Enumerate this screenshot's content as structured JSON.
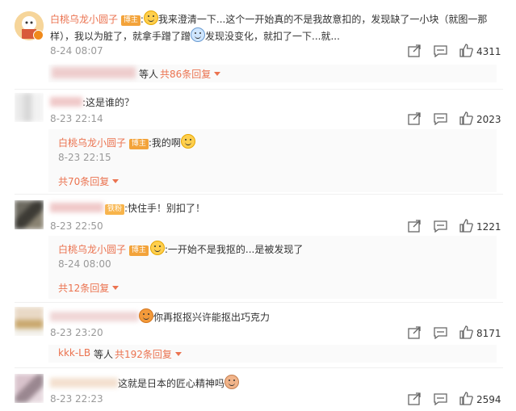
{
  "comments": [
    {
      "user": "白桃乌龙小圆子",
      "badge": "博主",
      "text": "我来澄清一下...这个一开始真的不是我故意扣的，发现缺了一小块（就图一那样），我以为脏了，就拿手蹭了蹭",
      "text_line1": "我来澄清一下...这个一开始真的不是我故意扣的，发现缺了一小块（就图一那",
      "text_line2_a": "样），我以为脏了，就拿手蹭了蹭",
      "text_line2_b": "发现没变化，就扣了一下...就...",
      "date": "8-24 08:07",
      "likes": "4311",
      "replies_summary_suffix": "等人",
      "replies_link": "共86条回复"
    },
    {
      "text": ":这是谁的？",
      "date": "8-23 22:14",
      "likes": "2023",
      "reply": {
        "user": "白桃乌龙小圆子",
        "badge": "博主",
        "text": ":我的啊",
        "date": "8-23 22:15"
      },
      "replies_link": "共70条回复"
    },
    {
      "fan_badge": "铁粉",
      "text": ":快住手！别扣了！",
      "date": "8-23 22:50",
      "likes": "1221",
      "reply": {
        "user": "白桃乌龙小圆子",
        "badge": "博主",
        "text": ":一开始不是我抠的...是被发现了",
        "date": "8-24 08:00"
      },
      "replies_link": "共12条回复"
    },
    {
      "text": "你再抠抠兴许能抠出巧克力",
      "date": "8-23 23:20",
      "likes": "8171",
      "replies_user": "kkk-LB",
      "replies_summary_suffix": "等人",
      "replies_link": "共192条回复"
    },
    {
      "text": "这就是日本的匠心精神吗",
      "date": "8-23 22:23",
      "likes": "2594"
    }
  ],
  "colors": {
    "accent": "#eb7350",
    "badge": "#f3a33a",
    "muted": "#999999"
  },
  "icons": [
    "share-icon",
    "comment-icon",
    "like-icon",
    "caret-down-icon",
    "vip-icon",
    "emoji-icon"
  ]
}
